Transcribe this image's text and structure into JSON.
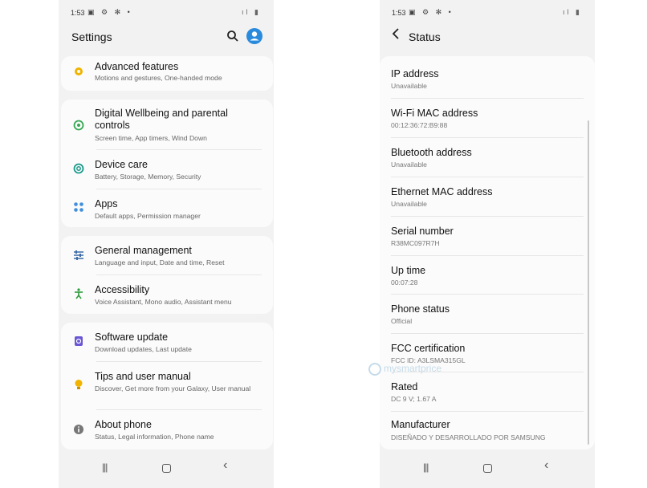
{
  "left": {
    "status_bar": {
      "time": "1:53",
      "icons": "▣ ⚙ ✻ •",
      "right": "ıl ▮"
    },
    "header": {
      "title": "Settings",
      "search_icon": "search-icon",
      "profile_icon": "profile-icon"
    },
    "cards": [
      {
        "items": [
          {
            "id": "advanced-features",
            "icon": "puzzle-icon",
            "icon_color": "#f0b400",
            "title": "Advanced features",
            "subtitle": "Motions and gestures, One-handed mode"
          }
        ]
      },
      {
        "items": [
          {
            "id": "digital-wellbeing",
            "icon": "wellbeing-icon",
            "icon_color": "#35a853",
            "title": "Digital Wellbeing and parental controls",
            "subtitle": "Screen time, App timers, Wind Down"
          },
          {
            "id": "device-care",
            "icon": "device-care-icon",
            "icon_color": "#1b9a8b",
            "title": "Device care",
            "subtitle": "Battery, Storage, Memory, Security"
          },
          {
            "id": "apps",
            "icon": "apps-icon",
            "icon_color": "#3f8fdd",
            "title": "Apps",
            "subtitle": "Default apps, Permission manager"
          }
        ]
      },
      {
        "items": [
          {
            "id": "general-management",
            "icon": "sliders-icon",
            "icon_color": "#3d6aa8",
            "title": "General management",
            "subtitle": "Language and input, Date and time, Reset"
          },
          {
            "id": "accessibility",
            "icon": "accessibility-icon",
            "icon_color": "#2d9c3c",
            "title": "Accessibility",
            "subtitle": "Voice Assistant, Mono audio, Assistant menu"
          }
        ]
      },
      {
        "items": [
          {
            "id": "software-update",
            "icon": "software-update-icon",
            "icon_color": "#6a57d4",
            "title": "Software update",
            "subtitle": "Download updates, Last update"
          },
          {
            "id": "tips-user-manual",
            "icon": "lightbulb-icon",
            "icon_color": "#f0b400",
            "title": "Tips and user manual",
            "subtitle": "Discover, Get more from your Galaxy, User manual"
          },
          {
            "id": "about-phone",
            "icon": "info-icon",
            "icon_color": "#777777",
            "title": "About phone",
            "subtitle": "Status, Legal information, Phone name"
          }
        ]
      }
    ]
  },
  "right": {
    "status_bar": {
      "time": "1:53",
      "icons": "▣ ⚙ ✻ •",
      "right": "ıl ▮"
    },
    "header": {
      "back_icon": "back-arrow-icon",
      "title": "Status"
    },
    "items": [
      {
        "title": "IP address",
        "value": "Unavailable"
      },
      {
        "title": "Wi-Fi MAC address",
        "value": "00:12:36:72:B9:88"
      },
      {
        "title": "Bluetooth address",
        "value": "Unavailable"
      },
      {
        "title": "Ethernet MAC address",
        "value": "Unavailable"
      },
      {
        "title": "Serial number",
        "value": "R38MC097R7H"
      },
      {
        "title": "Up time",
        "value": "00:07:28"
      },
      {
        "title": "Phone status",
        "value": "Official"
      },
      {
        "title": "FCC certification",
        "value": "FCC ID: A3LSMA315GL"
      },
      {
        "title": "Rated",
        "value": "DC 9 V; 1.67 A"
      },
      {
        "title": "Manufacturer",
        "value": "DISEÑADO Y DESARROLLADO POR SAMSUNG"
      }
    ]
  },
  "navbar": {
    "recent_icon": "recent-apps-icon",
    "home_icon": "home-icon",
    "back_icon": "back-icon",
    "recent_glyph": "|||",
    "back_glyph": "‹"
  },
  "watermark": {
    "text": "mysmartprice"
  }
}
